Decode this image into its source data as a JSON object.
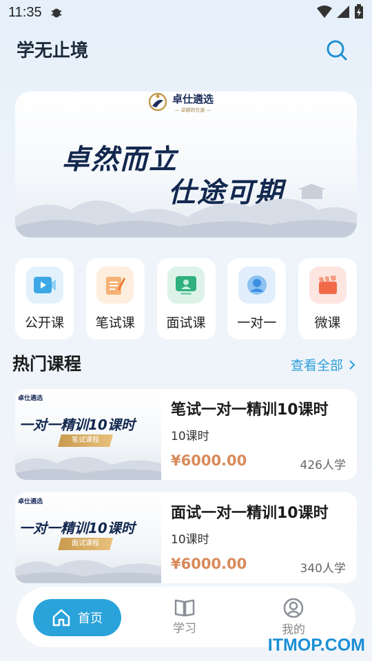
{
  "status_bar": {
    "time": "11:35"
  },
  "header": {
    "title": "学无止境"
  },
  "banner": {
    "logo_text": "卓仕遴选",
    "logo_sub": "— 卓越的仕途 —",
    "line1": "卓然而立",
    "line2": "仕途可期"
  },
  "categories": [
    {
      "label": "公开课",
      "icon": "video-icon",
      "color": "#3ea8e6"
    },
    {
      "label": "笔试课",
      "icon": "notepad-icon",
      "color": "#f08a3c"
    },
    {
      "label": "面试课",
      "icon": "interview-screen-icon",
      "color": "#2fb07c"
    },
    {
      "label": "一对一",
      "icon": "user-avatar-icon",
      "color": "#3d8fe0"
    },
    {
      "label": "微课",
      "icon": "clapperboard-icon",
      "color": "#f06a4a"
    }
  ],
  "section": {
    "title": "热门课程",
    "view_all": "查看全部"
  },
  "courses": [
    {
      "thumb_logo": "卓仕遴选",
      "thumb_title": "一对一精训10课时",
      "thumb_tag": "笔试课程",
      "title": "笔试一对一精训10课时",
      "lessons": "10课时",
      "price": "¥6000.00",
      "enrolled": "426人学"
    },
    {
      "thumb_logo": "卓仕遴选",
      "thumb_title": "一对一精训10课时",
      "thumb_tag": "面试课程",
      "title": "面试一对一精训10课时",
      "lessons": "10课时",
      "price": "¥6000.00",
      "enrolled": "340人学"
    }
  ],
  "tabbar": {
    "home": "首页",
    "study": "学习",
    "mine": "我的"
  },
  "watermark": "ITMOP.COM"
}
